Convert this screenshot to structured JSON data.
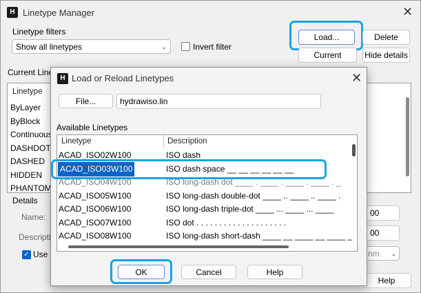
{
  "manager": {
    "title": "Linetype Manager",
    "filters_label": "Linetype filters",
    "filter_value": "Show all linetypes",
    "invert_label": "Invert filter",
    "load_label": "Load...",
    "delete_label": "Delete",
    "current_label": "Current",
    "hide_details_label": "Hide details",
    "current_linetype_label": "Current Linety",
    "col_linetype": "Linetype",
    "items": [
      "ByLayer",
      "ByBlock",
      "Continuous",
      "DASHDOT",
      "DASHED",
      "HIDDEN",
      "PHANTOM"
    ],
    "details_label": "Details",
    "name_label": "Name:",
    "description_label": "Descriptio",
    "use_label": "Use p",
    "scale1_value": "00",
    "scale2_value": "00",
    "units_value": "nm",
    "help_label": "Help"
  },
  "dialog": {
    "title": "Load or Reload Linetypes",
    "file_label": "File...",
    "file_value": "hydrawiso.lin",
    "available_label": "Available Linetypes",
    "col_linetype": "Linetype",
    "col_description": "Description",
    "rows": [
      {
        "name": "ACAD_ISO02W100",
        "desc": "ISO dash"
      },
      {
        "name": "ACAD_ISO03W100",
        "desc": "ISO dash space __  __  __  __  __  __"
      },
      {
        "name": "ACAD_ISO04W100",
        "desc": "ISO long-dash dot ____ . ____ . ____ . ____ . _"
      },
      {
        "name": "ACAD_ISO05W100",
        "desc": "ISO long-dash double-dot ____ .. ____ .. ____ ."
      },
      {
        "name": "ACAD_ISO06W100",
        "desc": "ISO long-dash triple-dot ____ ... ____ ... ____"
      },
      {
        "name": "ACAD_ISO07W100",
        "desc": "ISO dot . . . . . . . . . . . . . . . . . . . ."
      },
      {
        "name": "ACAD_ISO08W100",
        "desc": "ISO long-dash short-dash ____ __ ____ __ ____ _"
      }
    ],
    "ok_label": "OK",
    "cancel_label": "Cancel",
    "help_label": "Help"
  },
  "colors": {
    "highlight": "#1aa3df",
    "selection": "#0a64c8"
  }
}
